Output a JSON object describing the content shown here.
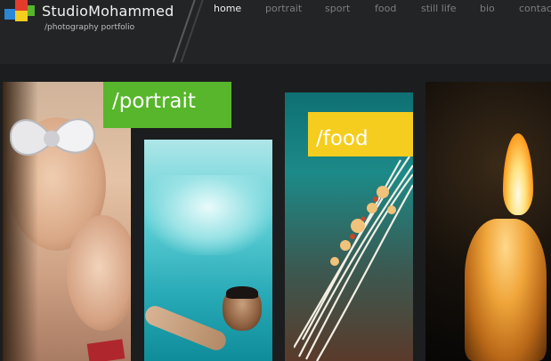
{
  "header": {
    "brand_name": "StudioMohammed",
    "tagline": "/photography portfolio",
    "logo_colors": [
      "#e53b2c",
      "#f5cd1e",
      "#57b62b",
      "#2b86d6"
    ]
  },
  "nav": {
    "items": [
      {
        "label": "home",
        "active": true
      },
      {
        "label": "portrait",
        "active": false
      },
      {
        "label": "sport",
        "active": false
      },
      {
        "label": "food",
        "active": false
      },
      {
        "label": "still life",
        "active": false
      },
      {
        "label": "bio",
        "active": false
      },
      {
        "label": "contac",
        "active": false
      }
    ]
  },
  "gallery": {
    "labels": {
      "portrait": "/portrait",
      "food": "/food"
    },
    "colors": {
      "portrait_label_bg": "#57b62b",
      "food_label_bg": "#f5cd1e"
    }
  }
}
